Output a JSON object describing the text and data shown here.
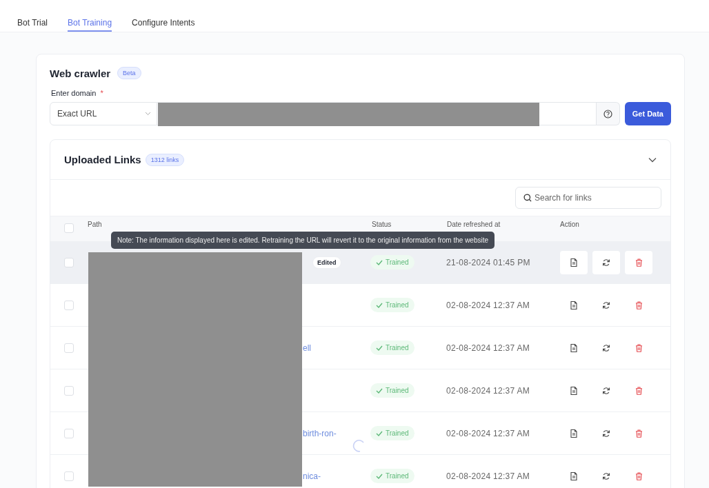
{
  "tabs": [
    {
      "label": "Bot Trial",
      "selected": false
    },
    {
      "label": "Bot Training",
      "selected": true
    },
    {
      "label": "Configure Intents",
      "selected": false
    }
  ],
  "crawler": {
    "title": "Web crawler",
    "badge": "Beta",
    "domain_label": "Enter domain",
    "required_mark": "*",
    "mode": "Exact URL",
    "button": "Get Data"
  },
  "links": {
    "title": "Uploaded Links",
    "count": "1312 links",
    "expanded": true,
    "search": {
      "placeholder": "Search for links"
    },
    "select_all_checked": false,
    "columns": [
      "Path",
      "Status",
      "Date refreshed at",
      "Action"
    ],
    "tooltip": "Note: The information displayed here is edited. Retraining the URL will revert it to the original information from the website",
    "rows": [
      {
        "path": "",
        "edited": true,
        "edited_label": "Edited",
        "status": "Trained",
        "date": "21-08-2024 01:45 PM",
        "hovered": true,
        "loading": false
      },
      {
        "path": "",
        "edited": false,
        "status": "Trained",
        "date": "02-08-2024 12:37 AM",
        "hovered": false,
        "loading": false
      },
      {
        "path": "ell",
        "edited": false,
        "status": "Trained",
        "date": "02-08-2024 12:37 AM",
        "hovered": false,
        "loading": false
      },
      {
        "path": "",
        "edited": false,
        "status": "Trained",
        "date": "02-08-2024 12:37 AM",
        "hovered": false,
        "loading": false
      },
      {
        "path": "birth-ron-",
        "edited": false,
        "status": "Trained",
        "date": "02-08-2024 12:37 AM",
        "hovered": false,
        "loading": true
      },
      {
        "path": "nica-",
        "edited": false,
        "status": "Trained",
        "date": "02-08-2024 12:37 AM",
        "hovered": false,
        "loading": false
      }
    ]
  }
}
